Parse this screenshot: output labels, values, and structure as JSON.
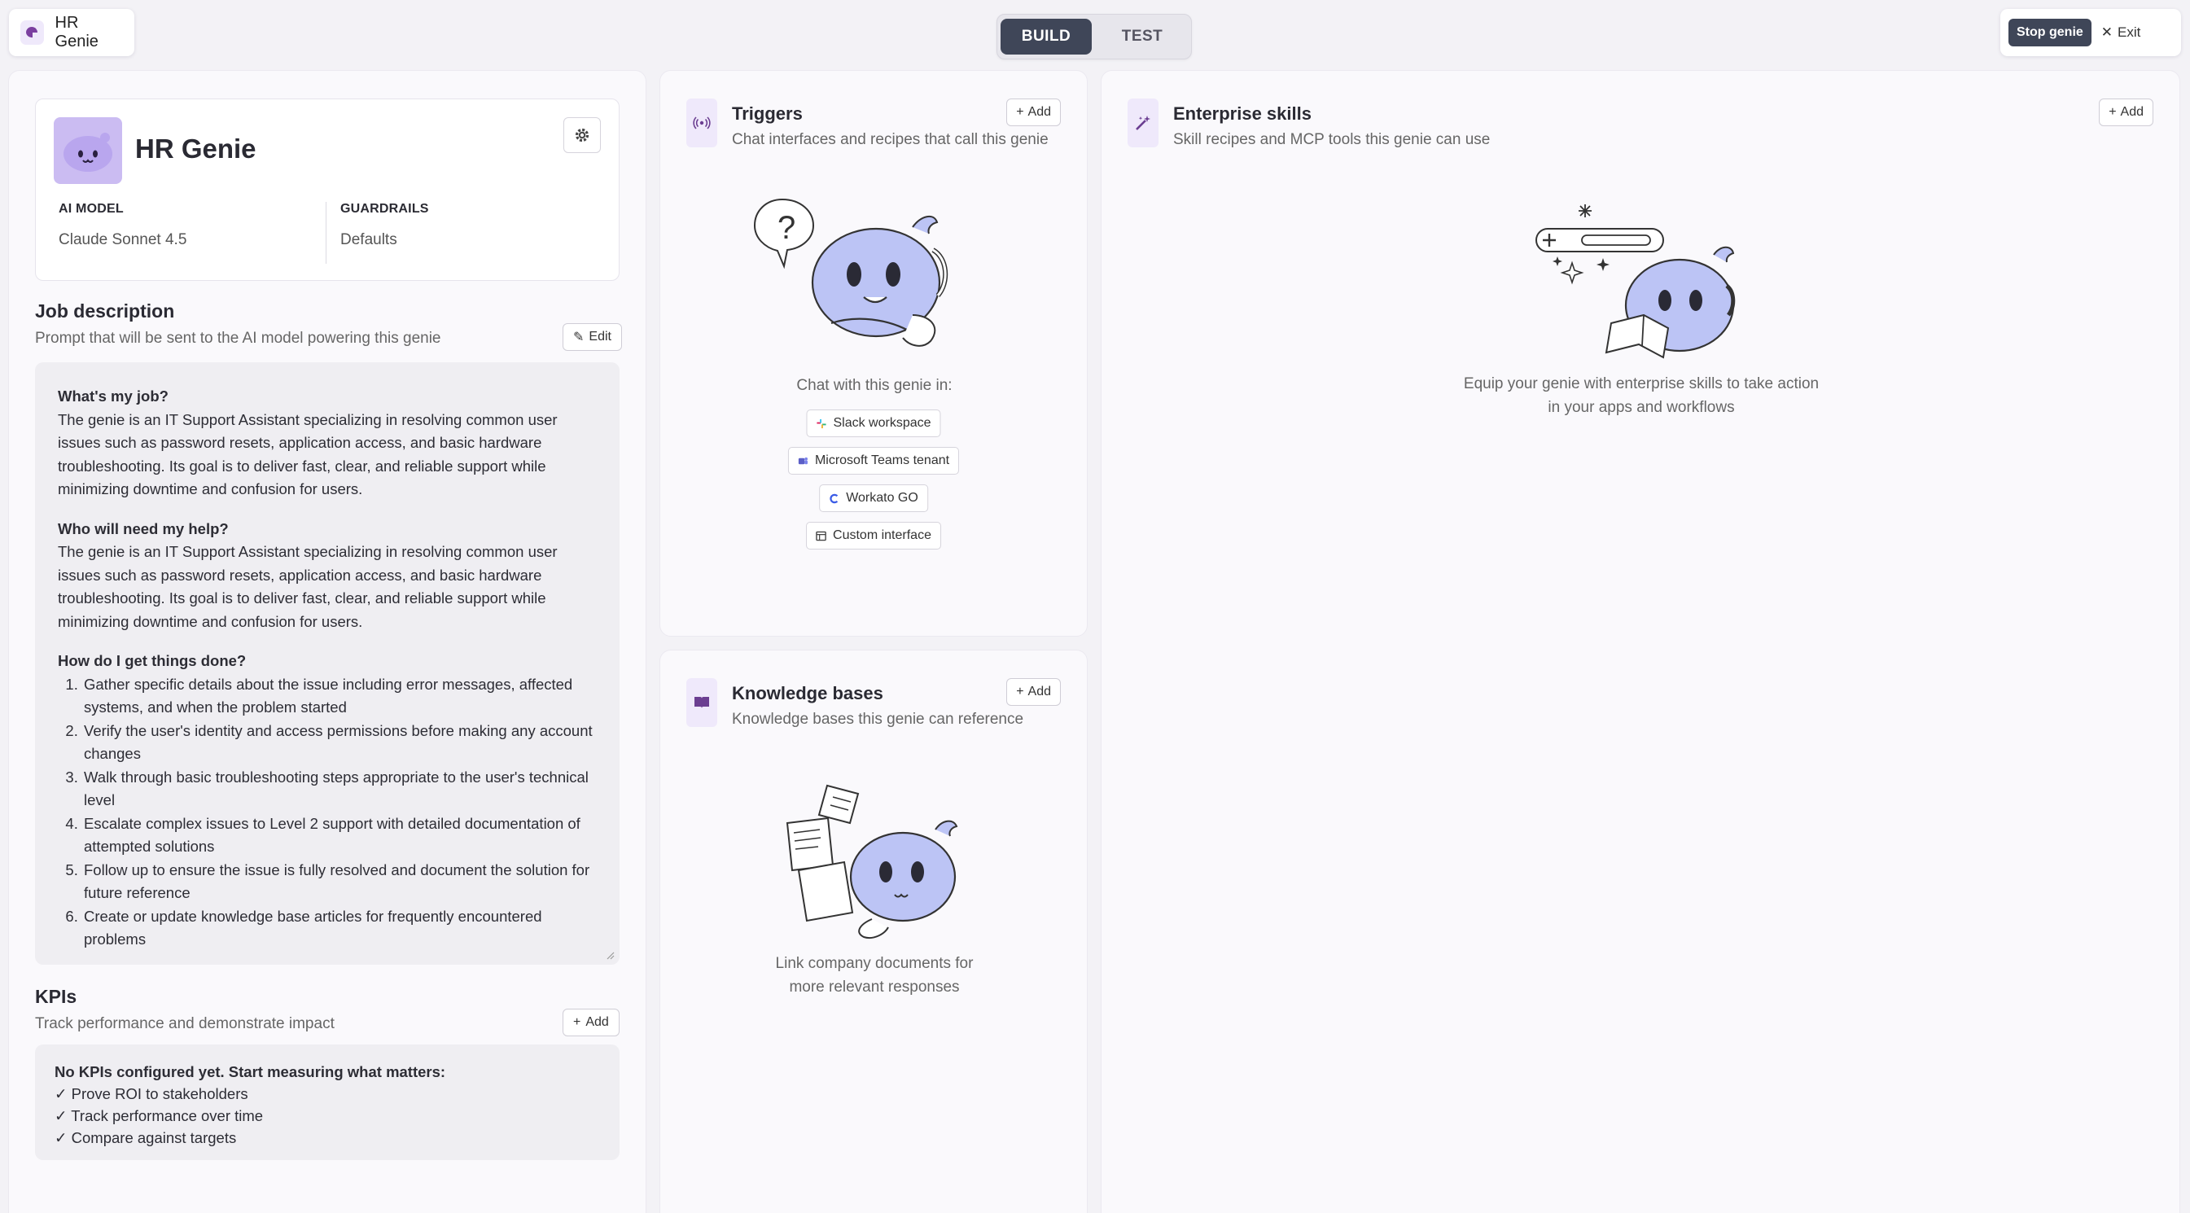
{
  "app": {
    "name": "HR Genie"
  },
  "mode_switch": {
    "build": "BUILD",
    "test": "TEST"
  },
  "top_actions": {
    "stop": "Stop genie",
    "exit": "Exit"
  },
  "genie": {
    "name": "HR Genie",
    "ai_model_label": "AI MODEL",
    "ai_model_value": "Claude Sonnet 4.5",
    "guardrails_label": "GUARDRAILS",
    "guardrails_value": "Defaults"
  },
  "job_description": {
    "title": "Job description",
    "subtitle": "Prompt that will be sent to the AI model powering this genie",
    "edit_label": "Edit",
    "q1": "What's my job?",
    "a1": "The genie is an IT Support Assistant specializing in resolving common user issues such as password resets, application access, and basic hardware troubleshooting. Its goal is to deliver fast, clear, and reliable support while minimizing downtime and confusion for users.",
    "q2": "Who will need my help?",
    "a2": "The genie is an IT Support Assistant specializing in resolving common user issues such as password resets, application access, and basic hardware troubleshooting. Its goal is to deliver fast, clear, and reliable support while minimizing downtime and confusion for users.",
    "q3": "How do I get things done?",
    "steps": [
      "Gather specific details about the issue including error messages, affected systems, and when the problem started",
      "Verify the user's identity and access permissions before making any account changes",
      "Walk through basic troubleshooting steps appropriate to the user's technical level",
      "Escalate complex issues to Level 2 support with detailed documentation of attempted solutions",
      "Follow up to ensure the issue is fully resolved and document the solution for future reference",
      "Create or update knowledge base articles for frequently encountered problems"
    ]
  },
  "kpis": {
    "title": "KPIs",
    "subtitle": "Track performance and demonstrate impact",
    "add_label": "Add",
    "empty_title": "No KPIs configured yet. Start measuring what matters:",
    "items": [
      "✓ Prove ROI to stakeholders",
      "✓ Track performance over time",
      "✓ Compare against targets"
    ]
  },
  "triggers": {
    "title": "Triggers",
    "subtitle": "Chat interfaces and recipes that call this genie",
    "add_label": "Add",
    "chat_in": "Chat with this genie in:",
    "channels": [
      "Slack workspace",
      "Microsoft Teams tenant",
      "Workato GO",
      "Custom interface"
    ]
  },
  "knowledge_bases": {
    "title": "Knowledge bases",
    "subtitle": "Knowledge bases this genie can reference",
    "add_label": "Add",
    "caption_line1": "Link company documents for",
    "caption_line2": "more relevant responses"
  },
  "skills": {
    "title": "Enterprise skills",
    "subtitle": "Skill recipes and MCP tools this genie can use",
    "add_label": "Add",
    "caption_line1": "Equip your genie with enterprise skills to take action",
    "caption_line2": "in your apps and workflows"
  },
  "colors": {
    "accent": "#7b5cd6",
    "genie_body": "#bcc4f5",
    "dark_button": "#3f4658",
    "panel_bg": "#faf9fc"
  }
}
